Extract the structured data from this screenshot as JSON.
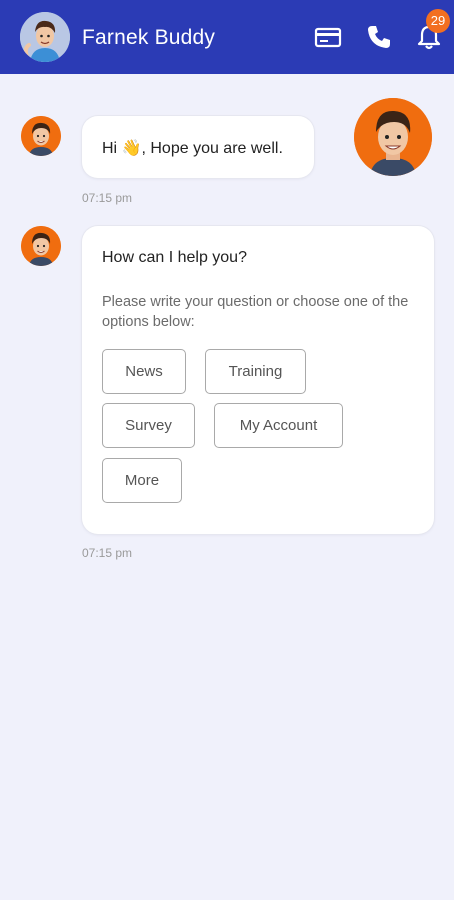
{
  "header": {
    "title": "Farnek Buddy",
    "notification_count": "29",
    "icons": [
      "avatar",
      "card-icon",
      "phone-icon",
      "bell-icon"
    ]
  },
  "chat": {
    "messages": [
      {
        "text": "Hi 👋, Hope you are well.",
        "time": "07:15 pm"
      },
      {
        "title": "How can I help you?",
        "subtitle": "Please write your question or choose one of the options below:",
        "options": [
          "News",
          "Training",
          "Survey",
          "My Account",
          "More"
        ],
        "time": "07:15 pm"
      }
    ]
  },
  "colors": {
    "header_bg": "#2b3bb5",
    "page_bg": "#f0f1fb",
    "badge": "#f26f21",
    "avatar_bg": "#f06d0f"
  }
}
